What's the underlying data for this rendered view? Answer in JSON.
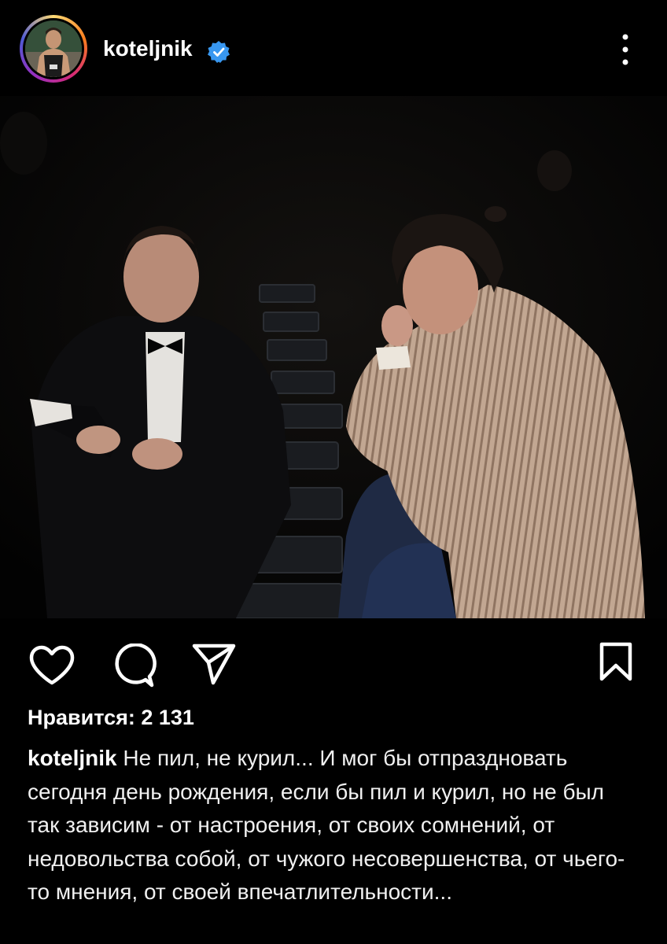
{
  "post": {
    "username": "koteljnik",
    "likes_label": "Нравится: 2 131",
    "caption_user": "koteljnik",
    "caption_text": " Не пил, не курил... И мог бы отпраздновать сегодня день рождения, если бы пил и курил, но не был так зависим - от настроения, от своих сомнений, от недовольства собой, от чужого несовершенства, от чьего-то мнения, от своей впечатлительности..."
  },
  "icons": {
    "verified": "verified-badge-icon",
    "more": "more-options-icon",
    "like": "heart-icon",
    "comment": "comment-icon",
    "share": "send-icon",
    "save": "bookmark-icon"
  },
  "colors": {
    "background": "#000000",
    "verified": "#3897f0",
    "text": "#f5f5f5"
  }
}
